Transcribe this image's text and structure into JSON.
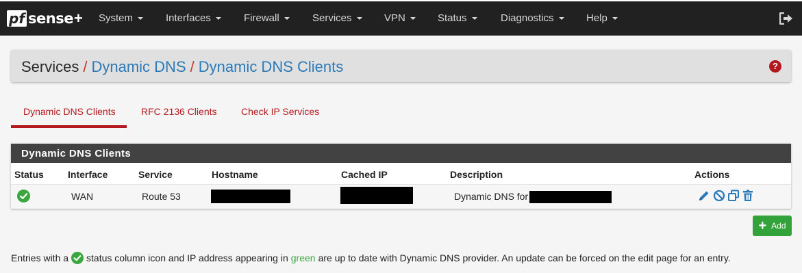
{
  "navbar": {
    "brand": {
      "pf": "pf",
      "sense": "sense",
      "plus": "+"
    },
    "items": [
      "System",
      "Interfaces",
      "Firewall",
      "Services",
      "VPN",
      "Status",
      "Diagnostics",
      "Help"
    ]
  },
  "breadcrumb": {
    "root": "Services",
    "sep": "/",
    "level1": "Dynamic DNS",
    "level2": "Dynamic DNS Clients"
  },
  "help": "?",
  "tabs": [
    "Dynamic DNS Clients",
    "RFC 2136 Clients",
    "Check IP Services"
  ],
  "panel": {
    "title": "Dynamic DNS Clients",
    "columns": [
      "Status",
      "Interface",
      "Service",
      "Hostname",
      "Cached IP",
      "Description",
      "Actions"
    ],
    "rows": [
      {
        "status": "ok",
        "interface": "WAN",
        "service": "Route 53",
        "hostname": "",
        "cached_ip": "",
        "description": "Dynamic DNS for"
      }
    ]
  },
  "add_button": {
    "label": "Add"
  },
  "note": {
    "part1": "Entries with a",
    "part2": "status column icon and IP address appearing in",
    "green_word": "green",
    "part3": "are up to date with Dynamic DNS provider. An update can be forced on the edit page for an entry."
  },
  "colors": {
    "accent": "#b5181c",
    "link": "#2c7ab8",
    "success": "#3aa83e",
    "navbar": "#212121"
  }
}
